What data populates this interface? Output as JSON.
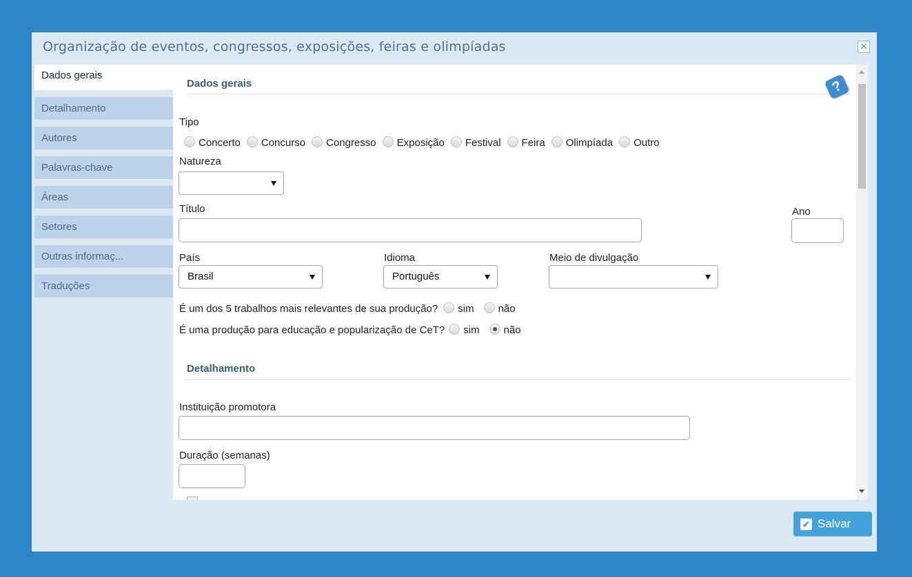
{
  "dialog": {
    "title": "Organização de eventos, congressos, exposições, feiras e olimpíadas",
    "close_icon": "close-icon"
  },
  "sidebar": {
    "items": [
      {
        "label": "Dados gerais"
      },
      {
        "label": "Detalhamento"
      },
      {
        "label": "Autores"
      },
      {
        "label": "Palavras-chave"
      },
      {
        "label": "Áreas"
      },
      {
        "label": "Setores"
      },
      {
        "label": "Outras informaç..."
      },
      {
        "label": "Traduções"
      }
    ],
    "active_index": 0
  },
  "form": {
    "section_general": "Dados gerais",
    "help_icon": "help-book-icon",
    "tipo": {
      "label": "Tipo",
      "options": [
        "Concerto",
        "Concurso",
        "Congresso",
        "Exposição",
        "Festival",
        "Feira",
        "Olimpíada",
        "Outro"
      ]
    },
    "natureza": {
      "label": "Natureza",
      "value": ""
    },
    "titulo": {
      "label": "Título",
      "value": ""
    },
    "ano": {
      "label": "Ano",
      "value": ""
    },
    "pais": {
      "label": "País",
      "value": "Brasil"
    },
    "idioma": {
      "label": "Idioma",
      "value": "Português"
    },
    "meio": {
      "label": "Meio de divulgação",
      "value": ""
    },
    "relevantes": {
      "question": "É um dos 5 trabalhos mais relevantes de sua produção?",
      "yes": "sim",
      "no": "não",
      "selected": null
    },
    "educacao": {
      "question": "É uma produção para educação e popularização de CeT?",
      "yes": "sim",
      "no": "não",
      "selected": "não"
    },
    "section_detail": "Detalhamento",
    "instituicao": {
      "label": "Instituição promotora",
      "value": ""
    },
    "duracao": {
      "label": "Duração (semanas)",
      "value": ""
    }
  },
  "footer": {
    "save_label": "Salvar"
  }
}
